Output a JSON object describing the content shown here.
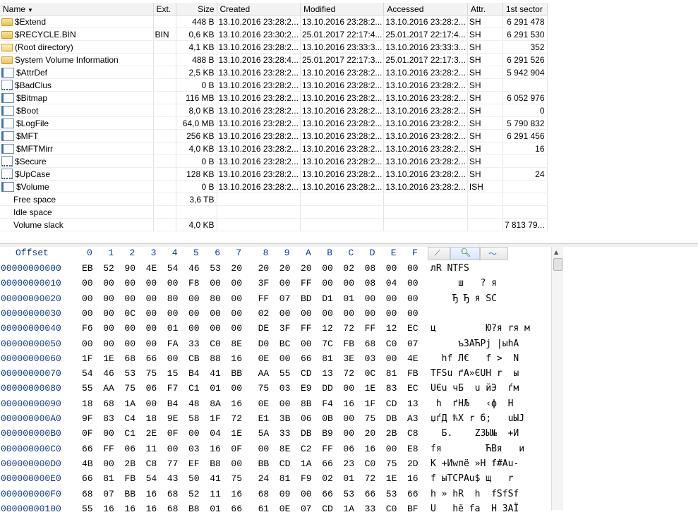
{
  "file_list": {
    "columns": [
      "Name",
      "Ext.",
      "Size",
      "Created",
      "Modified",
      "Accessed",
      "Attr.",
      "1st sector"
    ],
    "rows": [
      {
        "icon": "folder-icon",
        "name": "$Extend",
        "ext": "",
        "size": "448 B",
        "created": "13.10.2016  23:28:2...",
        "modified": "13.10.2016  23:28:2...",
        "accessed": "13.10.2016  23:28:2...",
        "attr": "SH",
        "sector": "6 291 478"
      },
      {
        "icon": "folder-icon",
        "name": "$RECYCLE.BIN",
        "ext": "BIN",
        "size": "0,6 KB",
        "created": "13.10.2016  23:30:2...",
        "modified": "25.01.2017  22:17:4...",
        "accessed": "25.01.2017  22:17:4...",
        "attr": "SH",
        "sector": "6 291 530"
      },
      {
        "icon": "open-folder-icon",
        "name": "(Root directory)",
        "ext": "",
        "size": "4,1 KB",
        "created": "13.10.2016  23:28:2...",
        "modified": "13.10.2016  23:33:3...",
        "accessed": "13.10.2016  23:33:3...",
        "attr": "SH",
        "sector": "352"
      },
      {
        "icon": "folder-icon",
        "name": "System Volume Information",
        "ext": "",
        "size": "488 B",
        "created": "13.10.2016  23:28:4...",
        "modified": "25.01.2017  22:17:3...",
        "accessed": "25.01.2017  22:17:3...",
        "attr": "SH",
        "sector": "6 291 526"
      },
      {
        "icon": "file-icon",
        "name": "$AttrDef",
        "ext": "",
        "size": "2,5 KB",
        "created": "13.10.2016  23:28:2...",
        "modified": "13.10.2016  23:28:2...",
        "accessed": "13.10.2016  23:28:2...",
        "attr": "SH",
        "sector": "5 942 904"
      },
      {
        "icon": "sparse-file-icon",
        "name": "$BadClus",
        "ext": "",
        "size": "0 B",
        "created": "13.10.2016  23:28:2...",
        "modified": "13.10.2016  23:28:2...",
        "accessed": "13.10.2016  23:28:2...",
        "attr": "SH",
        "sector": ""
      },
      {
        "icon": "file-icon",
        "name": "$Bitmap",
        "ext": "",
        "size": "116 MB",
        "created": "13.10.2016  23:28:2...",
        "modified": "13.10.2016  23:28:2...",
        "accessed": "13.10.2016  23:28:2...",
        "attr": "SH",
        "sector": "6 052 976"
      },
      {
        "icon": "file-icon",
        "name": "$Boot",
        "ext": "",
        "size": "8,0 KB",
        "created": "13.10.2016  23:28:2...",
        "modified": "13.10.2016  23:28:2...",
        "accessed": "13.10.2016  23:28:2...",
        "attr": "SH",
        "sector": "0"
      },
      {
        "icon": "file-icon",
        "name": "$LogFile",
        "ext": "",
        "size": "64,0 MB",
        "created": "13.10.2016  23:28:2...",
        "modified": "13.10.2016  23:28:2...",
        "accessed": "13.10.2016  23:28:2...",
        "attr": "SH",
        "sector": "5 790 832"
      },
      {
        "icon": "file-icon",
        "name": "$MFT",
        "ext": "",
        "size": "256 KB",
        "created": "13.10.2016  23:28:2...",
        "modified": "13.10.2016  23:28:2...",
        "accessed": "13.10.2016  23:28:2...",
        "attr": "SH",
        "sector": "6 291 456"
      },
      {
        "icon": "file-icon",
        "name": "$MFTMirr",
        "ext": "",
        "size": "4,0 KB",
        "created": "13.10.2016  23:28:2...",
        "modified": "13.10.2016  23:28:2...",
        "accessed": "13.10.2016  23:28:2...",
        "attr": "SH",
        "sector": "16"
      },
      {
        "icon": "sparse-file-icon",
        "name": "$Secure",
        "ext": "",
        "size": "0 B",
        "created": "13.10.2016  23:28:2...",
        "modified": "13.10.2016  23:28:2...",
        "accessed": "13.10.2016  23:28:2...",
        "attr": "SH",
        "sector": ""
      },
      {
        "icon": "sparse-file-icon",
        "name": "$UpCase",
        "ext": "",
        "size": "128 KB",
        "created": "13.10.2016  23:28:2...",
        "modified": "13.10.2016  23:28:2...",
        "accessed": "13.10.2016  23:28:2...",
        "attr": "SH",
        "sector": "24"
      },
      {
        "icon": "file-icon",
        "name": "$Volume",
        "ext": "",
        "size": "0 B",
        "created": "13.10.2016  23:28:2...",
        "modified": "13.10.2016  23:28:2...",
        "accessed": "13.10.2016  23:28:2...",
        "attr": "ISH",
        "sector": ""
      },
      {
        "icon": "blank-icon",
        "name": "Free space",
        "ext": "",
        "size": "3,6 TB",
        "created": "",
        "modified": "",
        "accessed": "",
        "attr": "",
        "sector": ""
      },
      {
        "icon": "blank-icon",
        "name": "Idle space",
        "ext": "",
        "size": "",
        "created": "",
        "modified": "",
        "accessed": "",
        "attr": "",
        "sector": ""
      },
      {
        "icon": "blank-icon",
        "name": "Volume slack",
        "ext": "",
        "size": "4,0 KB",
        "created": "",
        "modified": "",
        "accessed": "",
        "attr": "",
        "sector": "7 813 79..."
      }
    ]
  },
  "hex_view": {
    "offset_label": "Offset",
    "columns": [
      "0",
      "1",
      "2",
      "3",
      "4",
      "5",
      "6",
      "7",
      "8",
      "9",
      "A",
      "B",
      "C",
      "D",
      "E",
      "F"
    ],
    "toolbar_icons": [
      "text-mode-icon",
      "search-icon",
      "wave-icon"
    ],
    "rows": [
      {
        "offset": "00000000000",
        "bytes": "EB 52 90 4E 54 46 53 20 20 20 20 00 02 08 00 00",
        "text": "лR NTFS"
      },
      {
        "offset": "00000000010",
        "bytes": "00 00 00 00 00 F8 00 00 3F 00 FF 00 00 08 04 00",
        "text": "     ш   ? я"
      },
      {
        "offset": "00000000020",
        "bytes": "00 00 00 00 80 00 80 00 FF 07 BD D1 01 00 00 00",
        "text": "    Ђ Ђ я SC"
      },
      {
        "offset": "00000000030",
        "bytes": "00 00 0C 00 00 00 00 00 02 00 00 00 00 00 00 00",
        "text": ""
      },
      {
        "offset": "00000000040",
        "bytes": "F6 00 00 00 01 00 00 00 DE 3F FF 12 72 FF 12 EC",
        "text": "ц         Ю?я rя м"
      },
      {
        "offset": "00000000050",
        "bytes": "00 00 00 00 FA 33 C0 8E D0 BC 00 7C FB 68 C0 07",
        "text": "     ъ3АЋРј |ыhА"
      },
      {
        "offset": "00000000060",
        "bytes": "1F 1E 68 66 00 CB 88 16 0E 00 66 81 3E 03 00 4E",
        "text": "  hf Л€   f >  N"
      },
      {
        "offset": "00000000070",
        "bytes": "54 46 53 75 15 B4 41 BB AA 55 CD 13 72 0C 81 FB",
        "text": "TFSu ґA»ЄUН r  ы"
      },
      {
        "offset": "00000000080",
        "bytes": "55 AA 75 06 F7 C1 01 00 75 03 E9 DD 00 1E 83 EC",
        "text": "UЄu чБ  u йЭ  ѓм"
      },
      {
        "offset": "00000000090",
        "bytes": "18 68 1A 00 B4 48 8A 16 0E 00 8B F4 16 1F CD 13",
        "text": " h  ґHЉ   ‹ф  Н"
      },
      {
        "offset": "000000000A0",
        "bytes": "9F 83 C4 18 9E 58 1F 72 E1 3B 06 0B 00 75 DB A3",
        "text": "џѓД ћX r б;   uЫЈ"
      },
      {
        "offset": "000000000B0",
        "bytes": "0F 00 C1 2E 0F 00 04 1E 5A 33 DB B9 00 20 2B C8",
        "text": "  Б.    Z3Ы№  +И"
      },
      {
        "offset": "000000000C0",
        "bytes": "66 FF 06 11 00 03 16 0F 00 8E C2 FF 06 16 00 E8",
        "text": "fя        ЋВя   и"
      },
      {
        "offset": "000000000D0",
        "bytes": "4B 00 2B C8 77 EF B8 00 BB CD 1A 66 23 C0 75 2D",
        "text": "K +Иwпё »Н f#Аu-"
      },
      {
        "offset": "000000000E0",
        "bytes": "66 81 FB 54 43 50 41 75 24 81 F9 02 01 72 1E 16",
        "text": "f ыTCPAu$ щ   r"
      },
      {
        "offset": "000000000F0",
        "bytes": "68 07 BB 16 68 52 11 16 68 09 00 66 53 66 53 66",
        "text": "h » hR  h  fSfSf"
      },
      {
        "offset": "00000000100",
        "bytes": "55 16 16 16 68 B8 01 66 61 0E 07 CD 1A 33 C0 BF",
        "text": "U   hё fa  Н 3АЇ"
      }
    ]
  }
}
